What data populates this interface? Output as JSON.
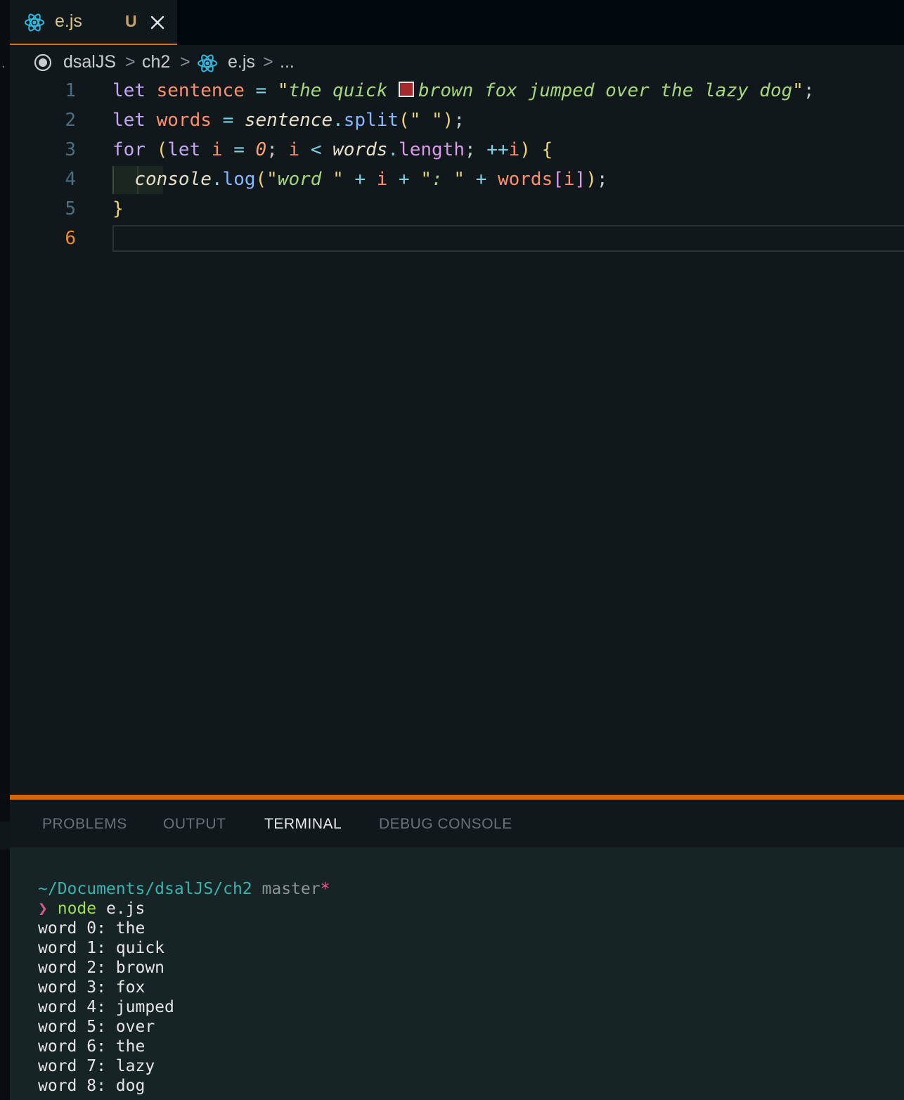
{
  "tab": {
    "filename": "e.js",
    "status": "U"
  },
  "left_strip": {
    "glyph": "."
  },
  "breadcrumb": {
    "items": [
      "dsalJS",
      "ch2",
      "e.js",
      "..."
    ],
    "separator": ">"
  },
  "editor": {
    "current_line": 6,
    "line_numbers": [
      "1",
      "2",
      "3",
      "4",
      "5",
      "6"
    ],
    "color_swatch": "#a52a2a",
    "lines": [
      [
        [
          "k",
          "let "
        ],
        [
          "v",
          "sentence"
        ],
        [
          "p",
          " "
        ],
        [
          "o",
          "="
        ],
        [
          "p",
          " "
        ],
        [
          "q",
          "\""
        ],
        [
          "s",
          "the quick "
        ],
        [
          "swatch",
          ""
        ],
        [
          "s",
          "brown fox jumped over the lazy dog"
        ],
        [
          "q",
          "\""
        ],
        [
          "p",
          ";"
        ]
      ],
      [
        [
          "k",
          "let "
        ],
        [
          "v",
          "words"
        ],
        [
          "p",
          " "
        ],
        [
          "o",
          "="
        ],
        [
          "p",
          " "
        ],
        [
          "i",
          "sentence"
        ],
        [
          "o",
          "."
        ],
        [
          "f",
          "split"
        ],
        [
          "b",
          "("
        ],
        [
          "q",
          "\""
        ],
        [
          "s",
          " "
        ],
        [
          "q",
          "\""
        ],
        [
          "b",
          ")"
        ],
        [
          "p",
          ";"
        ]
      ],
      [
        [
          "k",
          "for "
        ],
        [
          "b",
          "("
        ],
        [
          "k",
          "let "
        ],
        [
          "v",
          "i"
        ],
        [
          "p",
          " "
        ],
        [
          "o",
          "="
        ],
        [
          "p",
          " "
        ],
        [
          "n",
          "0"
        ],
        [
          "p",
          "; "
        ],
        [
          "v",
          "i"
        ],
        [
          "p",
          " "
        ],
        [
          "o",
          "<"
        ],
        [
          "p",
          " "
        ],
        [
          "i",
          "words"
        ],
        [
          "o",
          "."
        ],
        [
          "pk",
          "length"
        ],
        [
          "p",
          "; "
        ],
        [
          "o",
          "++"
        ],
        [
          "v",
          "i"
        ],
        [
          "b",
          ")"
        ],
        [
          "p",
          " "
        ],
        [
          "b",
          "{"
        ]
      ],
      [
        [
          "p",
          "  "
        ],
        [
          "i",
          "console"
        ],
        [
          "o",
          "."
        ],
        [
          "f",
          "log"
        ],
        [
          "b",
          "("
        ],
        [
          "q",
          "\""
        ],
        [
          "s",
          "word "
        ],
        [
          "q",
          "\""
        ],
        [
          "p",
          " "
        ],
        [
          "o",
          "+"
        ],
        [
          "p",
          " "
        ],
        [
          "v",
          "i"
        ],
        [
          "p",
          " "
        ],
        [
          "o",
          "+"
        ],
        [
          "p",
          " "
        ],
        [
          "q",
          "\""
        ],
        [
          "s",
          ": "
        ],
        [
          "q",
          "\""
        ],
        [
          "p",
          " "
        ],
        [
          "o",
          "+"
        ],
        [
          "p",
          " "
        ],
        [
          "v",
          "words"
        ],
        [
          "pk",
          "["
        ],
        [
          "v",
          "i"
        ],
        [
          "pk",
          "]"
        ],
        [
          "b",
          ")"
        ],
        [
          "p",
          ";"
        ]
      ],
      [
        [
          "b",
          "}"
        ]
      ],
      []
    ]
  },
  "panel": {
    "tabs": [
      "PROBLEMS",
      "OUTPUT",
      "TERMINAL",
      "DEBUG CONSOLE"
    ],
    "active_tab": "TERMINAL"
  },
  "terminal": {
    "cwd": "~/Documents/dsalJS/ch2",
    "branch": "master",
    "dirty_marker": "*",
    "prompt_symbol": "❯",
    "command": "node",
    "argument": "e.js",
    "output": [
      "word 0: the",
      "word 1: quick",
      "word 2: brown",
      "word 3: fox",
      "word 4: jumped",
      "word 5: over",
      "word 6: the",
      "word 7: lazy",
      "word 8: dog"
    ]
  }
}
